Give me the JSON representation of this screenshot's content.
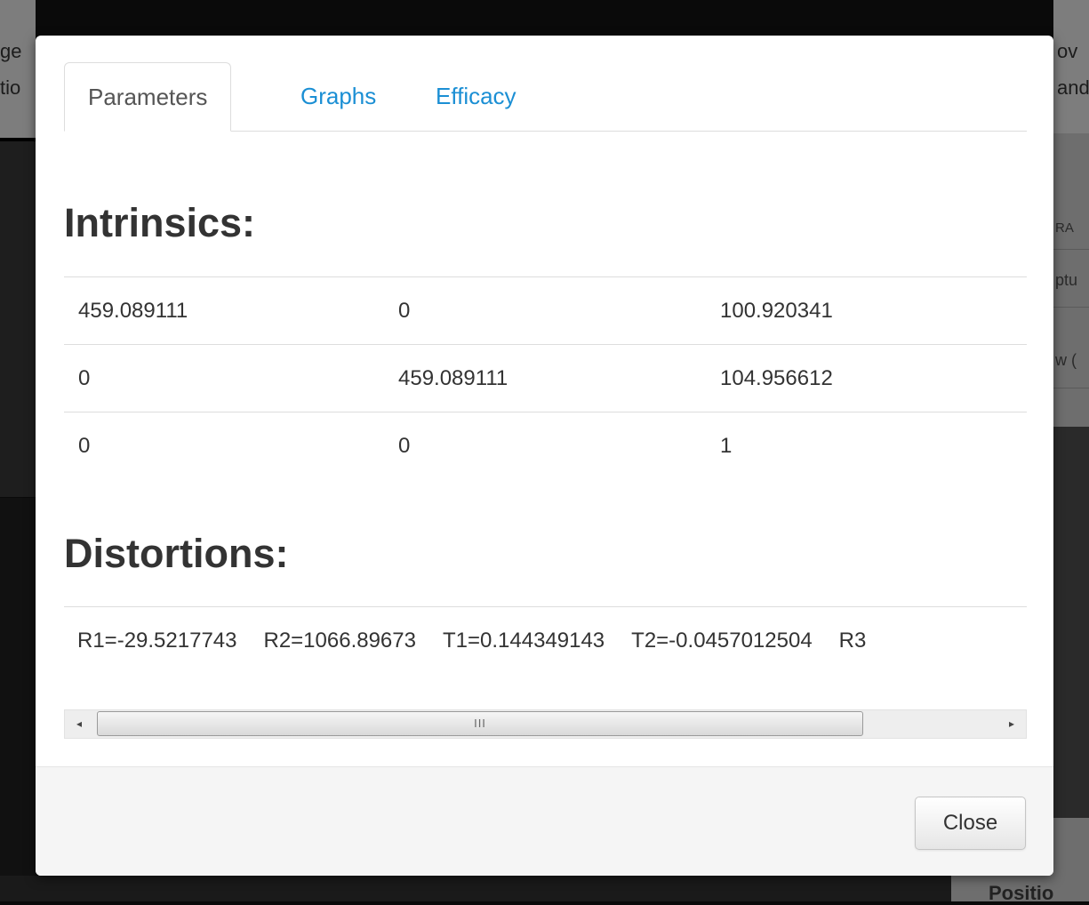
{
  "background": {
    "left_fragments": [
      "ge",
      "tio"
    ],
    "right_fragments": [
      "ov",
      "and"
    ],
    "right_panel_fragments": [
      "RA",
      "ptu",
      "w ("
    ],
    "bottom_right_fragment": "Positio"
  },
  "tabs": [
    {
      "label": "Parameters",
      "active": true
    },
    {
      "label": "Graphs",
      "active": false
    },
    {
      "label": "Efficacy",
      "active": false
    }
  ],
  "intrinsics": {
    "title": "Intrinsics:",
    "rows": [
      [
        "459.089111",
        "0",
        "100.920341"
      ],
      [
        "0",
        "459.089111",
        "104.956612"
      ],
      [
        "0",
        "0",
        "1"
      ]
    ]
  },
  "distortions": {
    "title": "Distortions:",
    "values": [
      "R1=-29.5217743",
      "R2=1066.89673",
      "T1=0.144349143",
      "T2=-0.0457012504",
      "R3"
    ]
  },
  "scrollbar": {
    "left_arrow": "◂",
    "right_arrow": "▸",
    "grip": "III"
  },
  "footer": {
    "close_label": "Close"
  },
  "colors": {
    "tab_link": "#1b8fd4",
    "heading": "#333333",
    "overlay": "#0a0a0a"
  }
}
